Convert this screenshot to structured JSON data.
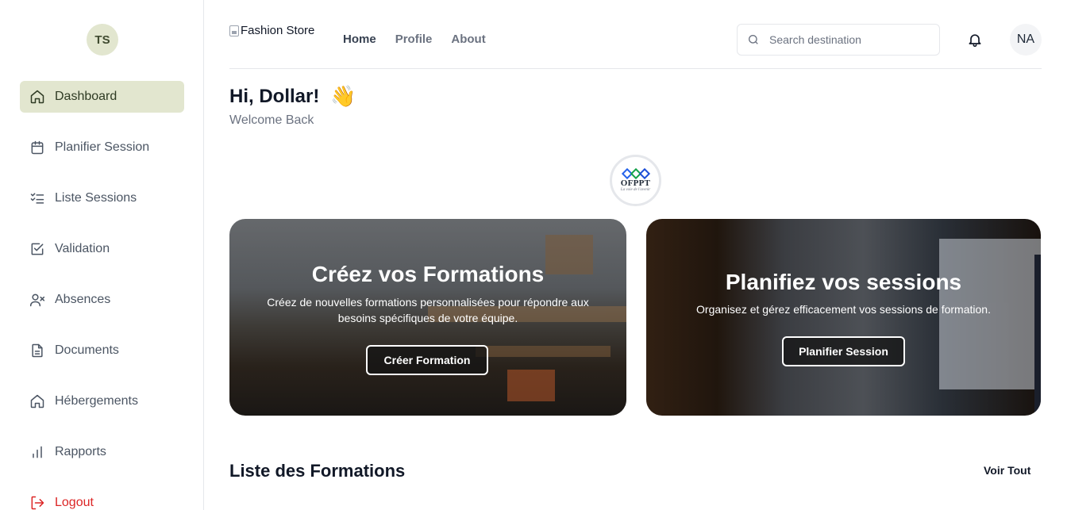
{
  "sidebar": {
    "logo_initials": "TS",
    "items": [
      {
        "label": "Dashboard",
        "icon": "home-icon"
      },
      {
        "label": "Planifier Session",
        "icon": "calendar-icon"
      },
      {
        "label": "Liste Sessions",
        "icon": "list-checks-icon"
      },
      {
        "label": "Validation",
        "icon": "check-square-icon"
      },
      {
        "label": "Absences",
        "icon": "user-x-icon"
      },
      {
        "label": "Documents",
        "icon": "file-text-icon"
      },
      {
        "label": "Hébergements",
        "icon": "home-icon"
      },
      {
        "label": "Rapports",
        "icon": "bar-chart-icon"
      },
      {
        "label": "Logout",
        "icon": "logout-icon"
      }
    ],
    "active_index": 0
  },
  "header": {
    "brand_alt": "Fashion Store",
    "nav": [
      "Home",
      "Profile",
      "About"
    ],
    "search_placeholder": "Search destination",
    "user_initials": "NA"
  },
  "greeting": {
    "title": "Hi, Dollar!",
    "emoji": "👋",
    "subtitle": "Welcome Back"
  },
  "logo": {
    "name": "OFPPT",
    "tagline": "La voie de l'avenir"
  },
  "cards": [
    {
      "title": "Créez vos Formations",
      "description": "Créez de nouvelles formations personnalisées pour répondre aux besoins spécifiques de votre équipe.",
      "button": "Créer Formation"
    },
    {
      "title": "Planifiez vos sessions",
      "description": "Organisez et gérez efficacement vos sessions de formation.",
      "button": "Planifier Session"
    }
  ],
  "formations_section": {
    "title": "Liste des Formations",
    "link": "Voir Tout"
  },
  "colors": {
    "accent_bg": "#e2e6cf",
    "logout": "#dc2626"
  }
}
